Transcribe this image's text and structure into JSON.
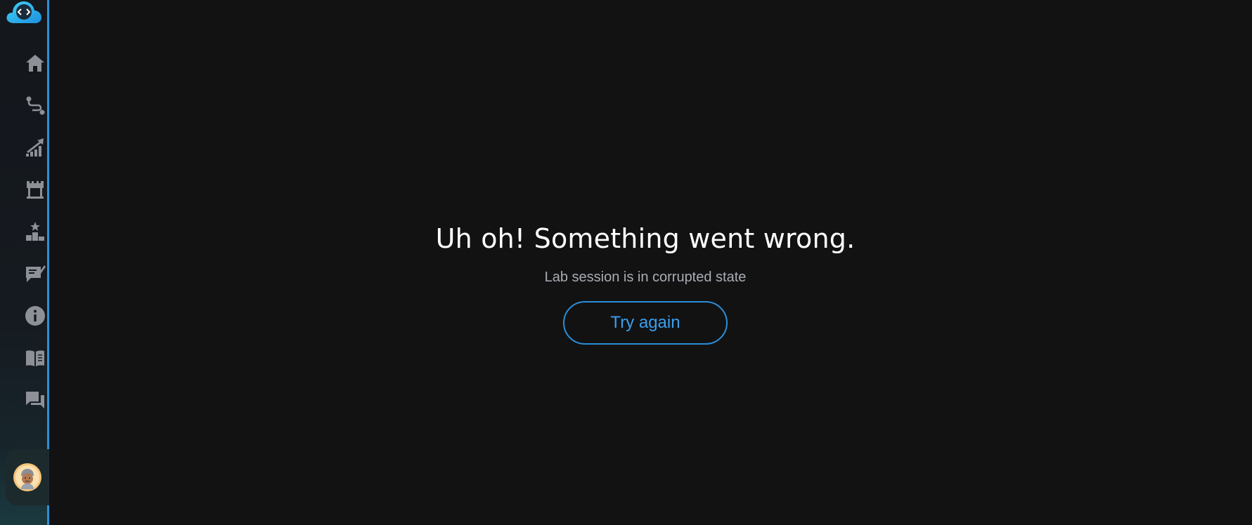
{
  "sidebar": {
    "logo_icon": "cloud-code-icon",
    "items": [
      {
        "icon": "home-icon",
        "name": "home"
      },
      {
        "icon": "route-icon",
        "name": "paths"
      },
      {
        "icon": "progress-chart-icon",
        "name": "progress"
      },
      {
        "icon": "lab-icon",
        "name": "labs"
      },
      {
        "icon": "leaderboard-icon",
        "name": "leaderboard"
      },
      {
        "icon": "feedback-icon",
        "name": "feedback"
      },
      {
        "icon": "info-icon",
        "name": "info"
      },
      {
        "icon": "book-icon",
        "name": "docs"
      },
      {
        "icon": "forum-icon",
        "name": "forum"
      }
    ],
    "avatar_icon": "user-avatar-icon"
  },
  "error": {
    "title": "Uh oh! Something went wrong.",
    "subtitle": "Lab session is in corrupted state",
    "button_label": "Try again"
  },
  "colors": {
    "background": "#121213",
    "accent": "#2b8fd9",
    "title": "#ffffff",
    "subtitle": "#a9adb4",
    "icon": "#8d9096"
  }
}
